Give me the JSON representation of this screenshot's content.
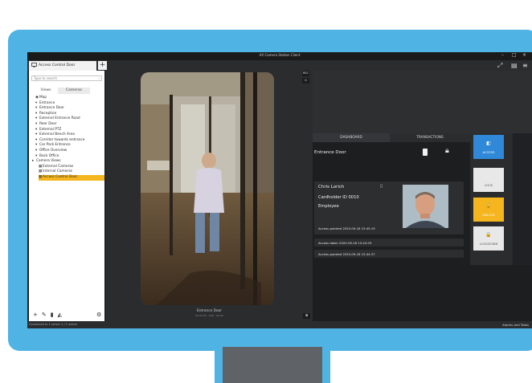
{
  "app": {
    "title": "AX Camera Station Client",
    "minimize": "–",
    "maximize": "□",
    "close": "×"
  },
  "tabs": [
    {
      "label": "Access Control Door"
    }
  ],
  "add_tab": "+",
  "sidebar": {
    "search_placeholder": "Type to search",
    "view_tabs": [
      "Views",
      "Cameras"
    ],
    "tree": [
      {
        "label": "Map",
        "icon": "map-icon",
        "glyph": "◉"
      },
      {
        "label": "Entrance",
        "icon": "camera-icon",
        "glyph": "▾"
      },
      {
        "label": "Entrance Door",
        "icon": "camera-icon",
        "glyph": "▾"
      },
      {
        "label": "Reception",
        "icon": "camera-icon",
        "glyph": "▾"
      },
      {
        "label": "External Entrance Road",
        "icon": "camera-icon",
        "glyph": "▾"
      },
      {
        "label": "Rear Door",
        "icon": "camera-icon",
        "glyph": "▾"
      },
      {
        "label": "External PTZ",
        "icon": "camera-icon",
        "glyph": "▾"
      },
      {
        "label": "External Bench Area",
        "icon": "camera-icon",
        "glyph": "▾"
      },
      {
        "label": "Corridor towards entrance",
        "icon": "camera-icon",
        "glyph": "▾"
      },
      {
        "label": "Car Park Entrance",
        "icon": "camera-icon",
        "glyph": "▾"
      },
      {
        "label": "Office Overview",
        "icon": "camera-icon",
        "glyph": "▾"
      },
      {
        "label": "Back Office",
        "icon": "camera-icon",
        "glyph": "▾"
      },
      {
        "label": "Camera Views",
        "icon": "folder-icon",
        "glyph": "▸"
      },
      {
        "label": "External Cameras",
        "icon": "grid-icon",
        "glyph": "▦"
      },
      {
        "label": "Internal Cameras",
        "icon": "grid-icon",
        "glyph": "▦"
      },
      {
        "label": "Access Control Door",
        "icon": "door-view-icon",
        "glyph": "▦"
      }
    ],
    "tools": [
      "+",
      "✎",
      "▮",
      "◭"
    ],
    "settings_glyph": "⚙"
  },
  "video": {
    "caption": "Entrance Door",
    "sub_caption": "00:00:00 - LIVE - 00:00",
    "rec_label": "REC"
  },
  "access": {
    "tabs": [
      "DASHBOARD",
      "TRANSACTIONS"
    ],
    "door_name": "Entrance Door",
    "card": {
      "name": "Chris Lorich",
      "holder": "Cardholder ID 0010",
      "role": "Employee",
      "event": "Access granted  2020-09-18 15:45:19"
    },
    "events": [
      "Access taken  2020-09-18 15:44:29",
      "Access granted  2020-09-18 15:44:37"
    ],
    "actions": [
      {
        "label": "ACCESS",
        "glyph": "◧",
        "bg": "#2f88d8",
        "fg": "#ffffff"
      },
      {
        "label": "LOCK",
        "glyph": "",
        "bg": "#e8e8e8",
        "fg": "#555555"
      },
      {
        "label": "UNLOCK",
        "glyph": "🔓",
        "bg": "#f4b51e",
        "fg": "#ffffff"
      },
      {
        "label": "LOCKDOWN",
        "glyph": "🔒",
        "bg": "#e8e8e8",
        "fg": "#555555"
      }
    ]
  },
  "status": {
    "left": "Connected to 1 server 1 / 1 active",
    "right": "Alarms and Tasks"
  },
  "colors": {
    "accent": "#4fb3e4",
    "highlight": "#f4b51e",
    "access": "#2f88d8"
  }
}
